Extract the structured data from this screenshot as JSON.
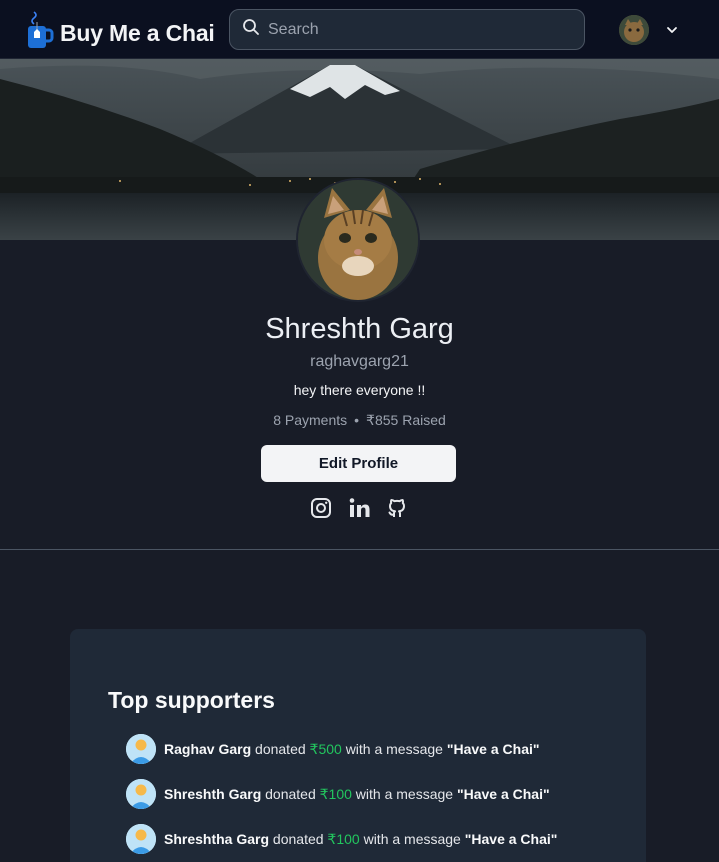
{
  "nav": {
    "brand": "Buy Me a Chai",
    "search_placeholder": "Search"
  },
  "profile": {
    "name": "Shreshth Garg",
    "username": "raghavgarg21",
    "bio": "hey there everyone !!",
    "payments": "8 Payments",
    "raised": "₹855 Raised",
    "edit_button": "Edit Profile"
  },
  "supporters": {
    "title": "Top supporters",
    "items": [
      {
        "name": "Raghav Garg",
        "verb": "donated",
        "amount": "₹500",
        "mid": "with a message",
        "message": "\"Have a Chai\""
      },
      {
        "name": "Shreshth Garg",
        "verb": "donated",
        "amount": "₹100",
        "mid": "with a message",
        "message": "\"Have a Chai\""
      },
      {
        "name": "Shreshtha Garg",
        "verb": "donated",
        "amount": "₹100",
        "mid": "with a message",
        "message": "\"Have a Chai\""
      }
    ]
  },
  "icons": {
    "search": "search-icon",
    "caret": "chevron-down-icon",
    "instagram": "instagram-icon",
    "linkedin": "linkedin-icon",
    "github": "github-icon"
  },
  "colors": {
    "background": "#181c27",
    "nav": "#0b1020",
    "card": "#1f2937",
    "amount": "#22c55e",
    "brand_mug": "#1d6fd6"
  }
}
